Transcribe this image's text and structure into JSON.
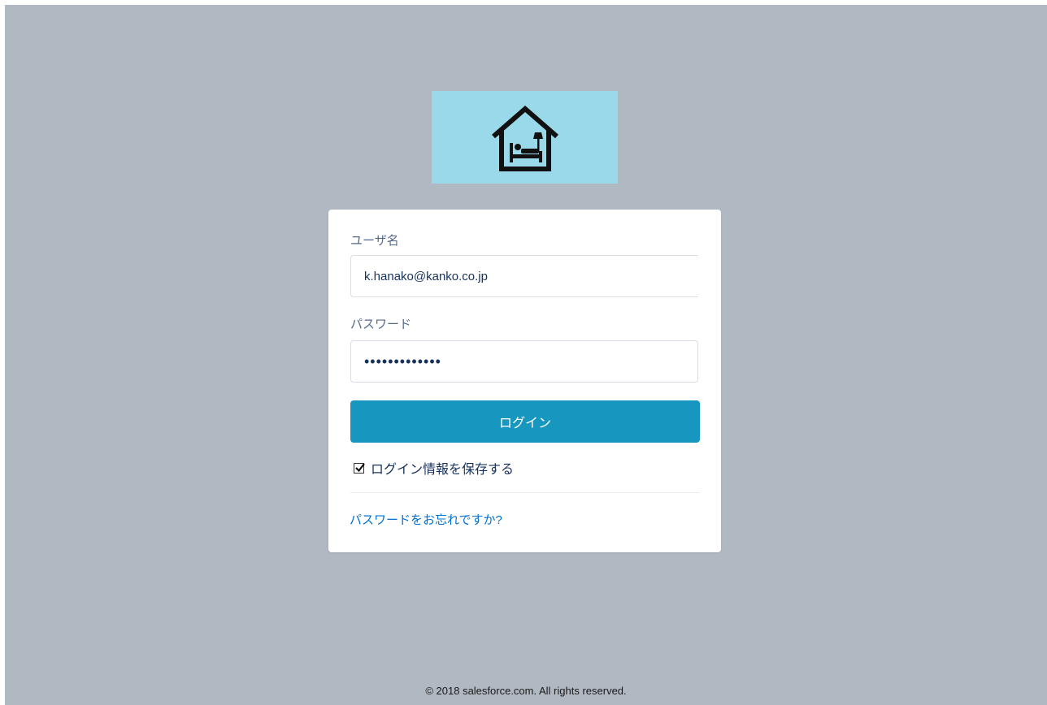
{
  "logo": {
    "icon": "house-bed-icon",
    "background": "#9ad9ea"
  },
  "login_form": {
    "username_label": "ユーザ名",
    "username_value": "k.hanako@kanko.co.jp",
    "password_label": "パスワード",
    "password_value": "•••••••••••••",
    "login_button_label": "ログイン",
    "remember_label": "ログイン情報を保存する",
    "remember_checked": true,
    "forgot_link": "パスワードをお忘れですか?"
  },
  "colors": {
    "page_background": "#b0b8c1",
    "button": "#1797c0",
    "link": "#0070d2",
    "label": "#54698d"
  },
  "footer": {
    "copyright": "© 2018 salesforce.com. All rights reserved."
  }
}
